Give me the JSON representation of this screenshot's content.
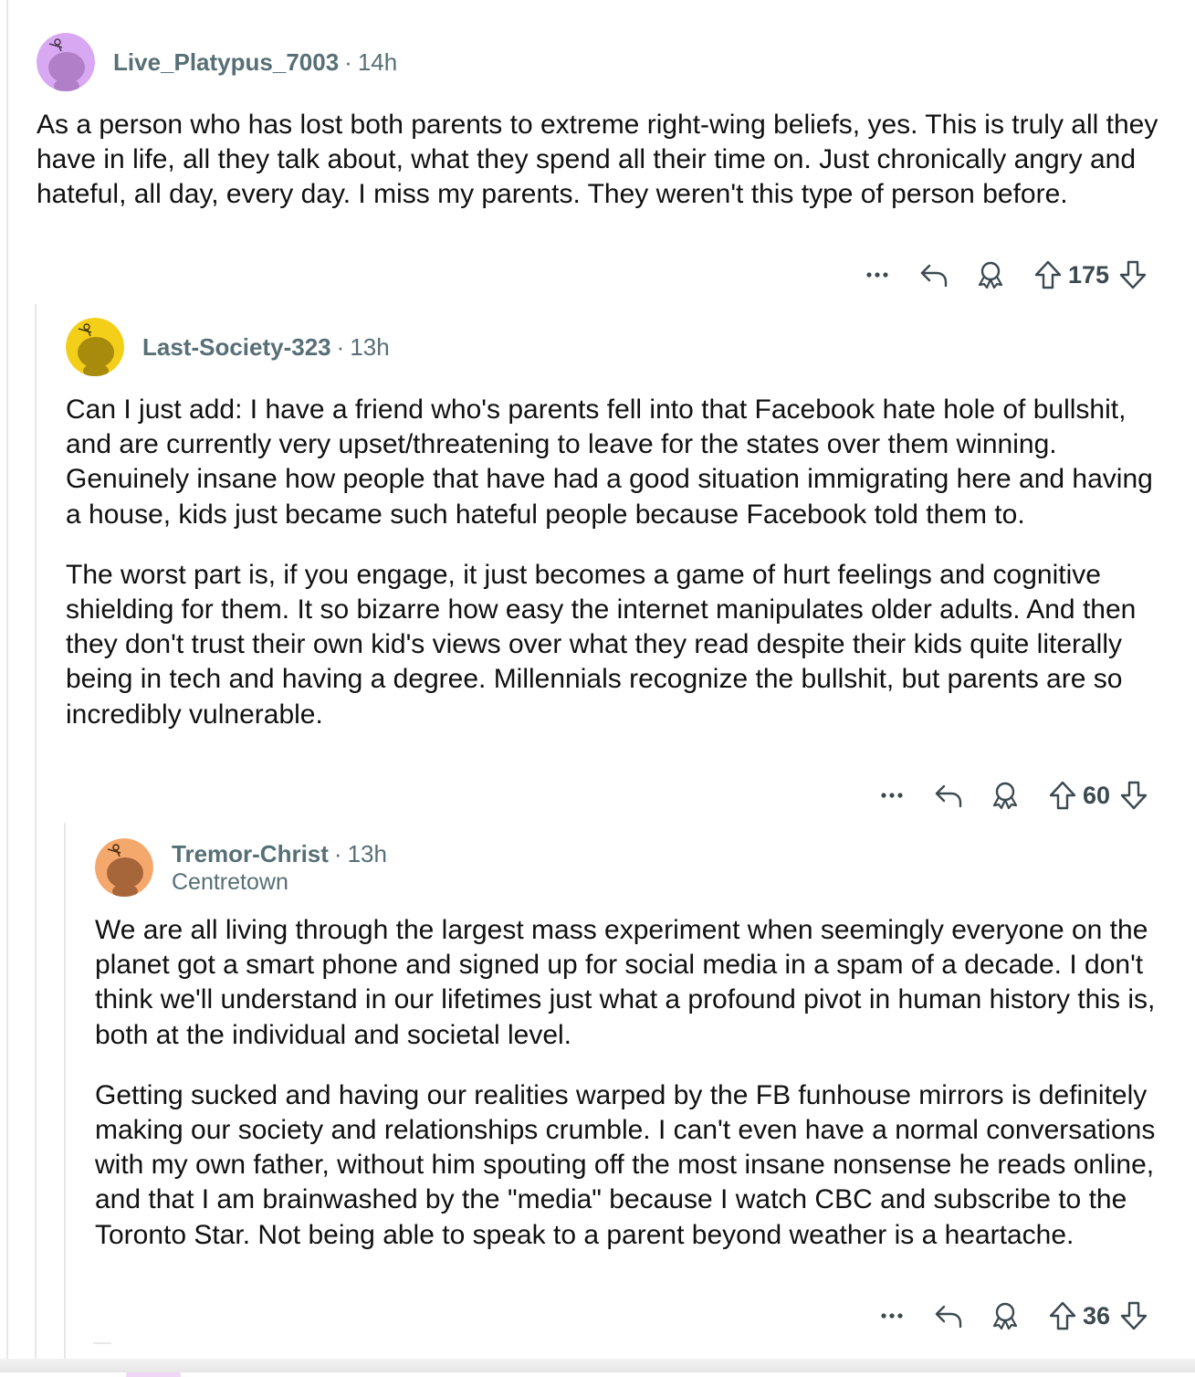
{
  "comments": [
    {
      "username": "Live_Platypus_7003",
      "age": "14h",
      "flair": "",
      "avatar_color": "#d9a8f2",
      "paragraphs": [
        "As a person who has lost both parents to extreme right-wing beliefs, yes. This is truly all they have in life, all they talk about, what they spend all their time on. Just chronically angry and hateful, all day, every day. I miss my parents. They weren't this type of person before."
      ],
      "score": "175"
    },
    {
      "username": "Last-Society-323",
      "age": "13h",
      "flair": "",
      "avatar_color": "#f4cf1a",
      "paragraphs": [
        "Can I just add: I have a friend who's parents fell into that Facebook hate hole of bullshit, and are currently very upset/threatening to leave for the states over them winning. Genuinely insane how people that have had a good situation immigrating here and having a house, kids just became such hateful people because Facebook told them to.",
        "The worst part is, if you engage, it just becomes a game of hurt feelings and cognitive shielding for them. It so bizarre how easy the internet manipulates older adults. And then they don't trust their own kid's views over what they read despite their kids quite literally being in tech and having a degree. Millennials recognize the bullshit, but parents are so incredibly vulnerable."
      ],
      "score": "60"
    },
    {
      "username": "Tremor-Christ",
      "age": "13h",
      "flair": "Centretown",
      "avatar_color": "#f5a86c",
      "paragraphs": [
        "We are all living through the largest mass experiment when seemingly everyone on the planet got a smart phone and signed up for social media in a spam of a decade. I don't think we'll understand in our lifetimes just what a profound pivot in human history this is, both at the individual and societal level.",
        "Getting sucked and having our realities warped by the FB funhouse mirrors is definitely making our society and relationships crumble. I can't even have a normal conversations with my own father, without him spouting off the most insane nonsense he reads online, and that I am brainwashed by the \"media\" because I watch CBC and subscribe to the Toronto Star. Not being able to speak to a parent beyond weather is a heartache."
      ],
      "score": "36"
    }
  ],
  "icons": {
    "more": "more-icon",
    "reply": "reply-icon",
    "award": "award-icon",
    "upvote": "upvote-icon",
    "downvote": "downvote-icon"
  }
}
